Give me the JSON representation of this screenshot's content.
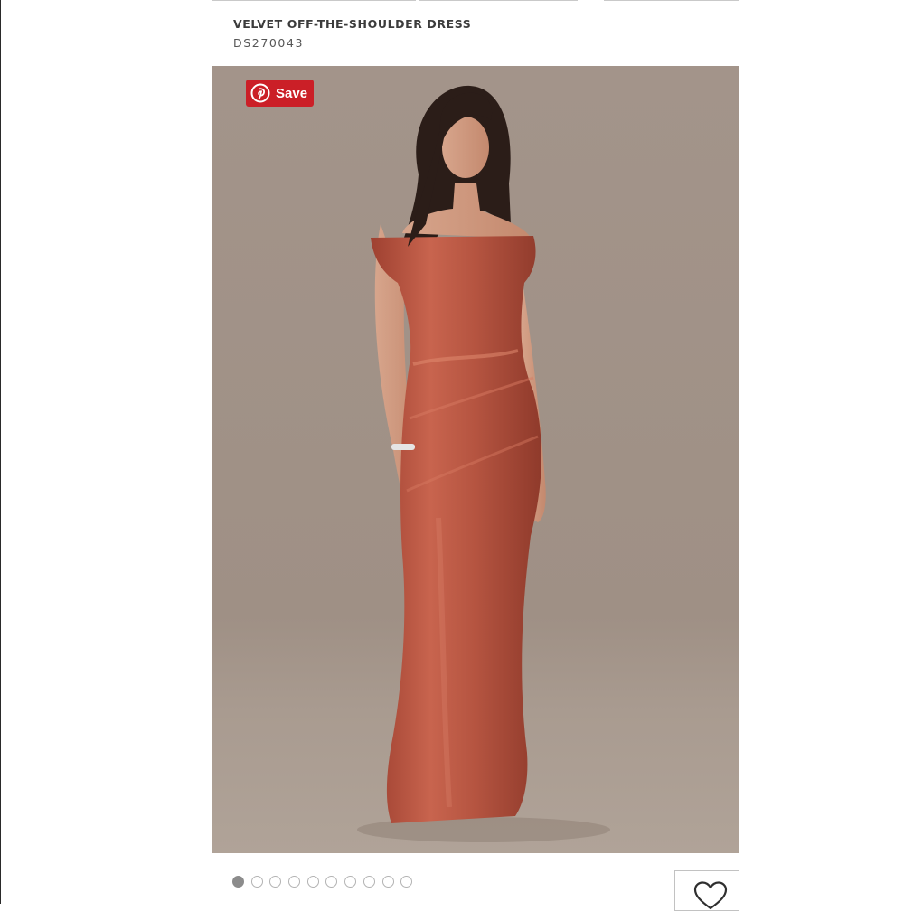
{
  "product": {
    "title": "VELVET OFF-THE-SHOULDER DRESS",
    "sku": "DS270043"
  },
  "pinterest": {
    "save_label": "Save",
    "icon": "pinterest-icon",
    "color": "#cb1f27"
  },
  "gallery": {
    "image_count": 10,
    "active_index": 0,
    "background_color": "#a4958a",
    "dress_color": "#b9533f"
  },
  "favorite": {
    "icon": "heart-icon"
  }
}
